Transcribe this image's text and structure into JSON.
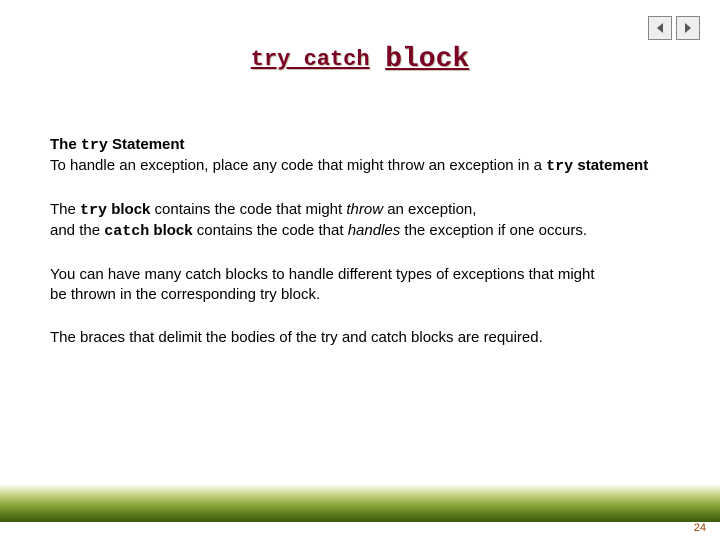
{
  "nav": {
    "prev_icon": "prev-arrow-icon",
    "next_icon": "next-arrow-icon"
  },
  "title": {
    "trycatch": "try catch",
    "block": "block"
  },
  "body": {
    "p1_l1a": "The ",
    "p1_l1b": "try",
    "p1_l1c": " Statement",
    "p1_l2a": "To handle an exception, place any code that might throw an exception in a ",
    "p1_l2b": "try",
    "p1_l2c": " statement",
    "p2_a": "The ",
    "p2_b": "try",
    "p2_c": " block",
    "p2_d": "  contains the code that might ",
    "p2_e": "throw",
    "p2_f": " an exception,",
    "p2_g": "and the ",
    "p2_h": "catch",
    "p2_i": " block",
    "p2_j": " contains the code that ",
    "p2_k": "handles",
    "p2_l": " the exception if one occurs.",
    "p3_a": "You can have many catch blocks to handle different types of exceptions that might",
    "p3_b": "be thrown in the corresponding try block.",
    "p4": "The braces that delimit the bodies of the try and catch blocks are required."
  },
  "page_number": "24"
}
